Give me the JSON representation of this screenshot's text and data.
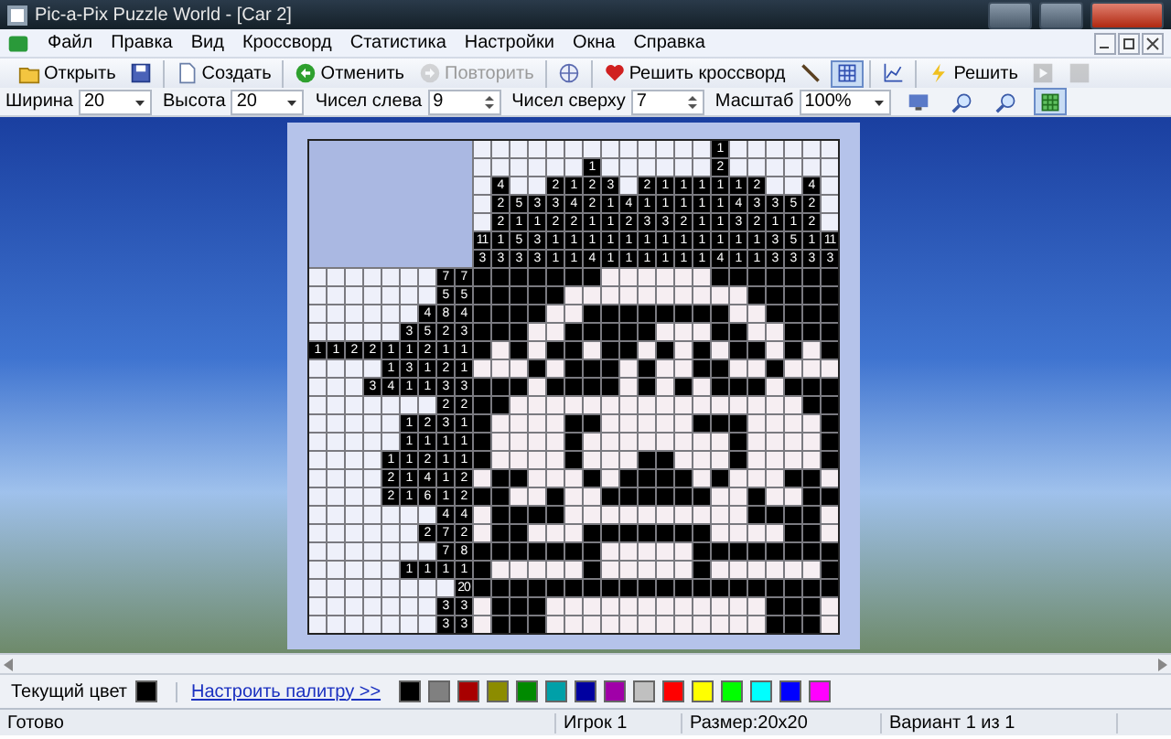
{
  "window": {
    "title": "Pic-a-Pix Puzzle World - [Car 2]"
  },
  "menu": [
    "Файл",
    "Правка",
    "Вид",
    "Кроссворд",
    "Статистика",
    "Настройки",
    "Окна",
    "Справка"
  ],
  "toolbar": [
    {
      "items": [
        {
          "label": "Открыть",
          "disabled": false,
          "pressed": false
        },
        {
          "disabled": false,
          "pressed": false
        }
      ]
    },
    {
      "items": [
        {
          "label": "Создать",
          "disabled": false,
          "pressed": false
        }
      ]
    },
    {
      "items": [
        {
          "label": "Отменить",
          "disabled": false,
          "pressed": false
        },
        {
          "label": "Повторить",
          "disabled": true,
          "pressed": false
        }
      ]
    },
    {
      "items": [
        {
          "disabled": false,
          "pressed": false
        }
      ]
    },
    {
      "items": [
        {
          "label": "Решить кроссворд",
          "disabled": false,
          "pressed": false
        },
        {
          "disabled": false,
          "pressed": false
        },
        {
          "disabled": false,
          "pressed": true
        }
      ]
    },
    {
      "items": [
        {
          "disabled": false,
          "pressed": false
        }
      ]
    },
    {
      "items": [
        {
          "label": "Решить",
          "disabled": false,
          "pressed": false
        },
        {
          "disabled": true,
          "pressed": false
        },
        {
          "disabled": true,
          "pressed": false
        }
      ]
    }
  ],
  "settings": [
    {
      "kind": "dropdown",
      "label": "Ширина",
      "value": "20"
    },
    {
      "kind": "dropdown",
      "label": "Высота",
      "value": "20"
    },
    {
      "kind": "spinner",
      "label": "Чисел слева",
      "value": "9"
    },
    {
      "kind": "spinner",
      "label": "Чисел сверху",
      "value": "7"
    },
    {
      "kind": "dropdown",
      "label": "Масштаб",
      "value": "100%"
    }
  ],
  "view_buttons": [
    {
      "pressed": false
    },
    {
      "pressed": false
    },
    {
      "pressed": false
    },
    {
      "pressed": true
    }
  ],
  "puzzle": {
    "column_clues": [
      [
        "11",
        "3"
      ],
      [
        "4",
        "2",
        "2",
        "1",
        "3"
      ],
      [
        "5",
        "1",
        "5",
        "3"
      ],
      [
        "3",
        "1",
        "3",
        "3"
      ],
      [
        "2",
        "3",
        "2",
        "1",
        "1"
      ],
      [
        "1",
        "4",
        "2",
        "1",
        "1"
      ],
      [
        "1",
        "2",
        "2",
        "1",
        "1",
        "4"
      ],
      [
        "3",
        "1",
        "1",
        "1",
        "1"
      ],
      [
        "4",
        "2",
        "1",
        "1"
      ],
      [
        "2",
        "1",
        "3",
        "1",
        "1"
      ],
      [
        "1",
        "1",
        "3",
        "1",
        "1"
      ],
      [
        "1",
        "1",
        "2",
        "1",
        "1"
      ],
      [
        "1",
        "1",
        "1",
        "1",
        "1"
      ],
      [
        "1",
        "2",
        "1",
        "1",
        "1",
        "1",
        "4"
      ],
      [
        "1",
        "4",
        "3",
        "1",
        "1"
      ],
      [
        "2",
        "3",
        "2",
        "1",
        "1"
      ],
      [
        "3",
        "1",
        "3",
        "3"
      ],
      [
        "5",
        "1",
        "5",
        "3"
      ],
      [
        "4",
        "2",
        "2",
        "1",
        "3"
      ],
      [
        "11",
        "3"
      ]
    ],
    "row_clues": [
      [
        "7",
        "7"
      ],
      [
        "5",
        "5"
      ],
      [
        "4",
        "8",
        "4"
      ],
      [
        "3",
        "5",
        "2",
        "3"
      ],
      [
        "1",
        "1",
        "2",
        "2",
        "1",
        "1",
        "2",
        "1",
        "1"
      ],
      [
        "1",
        "3",
        "1",
        "2",
        "1"
      ],
      [
        "3",
        "4",
        "1",
        "1",
        "3",
        "3"
      ],
      [
        "2",
        "2"
      ],
      [
        "1",
        "2",
        "3",
        "1"
      ],
      [
        "1",
        "1",
        "1",
        "1"
      ],
      [
        "1",
        "1",
        "2",
        "1",
        "1"
      ],
      [
        "2",
        "1",
        "4",
        "1",
        "2"
      ],
      [
        "2",
        "1",
        "6",
        "1",
        "2"
      ],
      [
        "4",
        "4"
      ],
      [
        "2",
        "7",
        "2"
      ],
      [
        "7",
        "8"
      ],
      [
        "1",
        "1",
        "1",
        "1"
      ],
      [
        "20"
      ],
      [
        "3",
        "3"
      ],
      [
        "3",
        "3"
      ]
    ],
    "cells": [
      [
        true,
        true,
        true,
        true,
        true,
        true,
        true,
        false,
        false,
        false,
        false,
        false,
        false,
        true,
        true,
        true,
        true,
        true,
        true,
        true
      ],
      [
        true,
        true,
        true,
        true,
        true,
        false,
        false,
        false,
        false,
        false,
        false,
        false,
        false,
        false,
        false,
        true,
        true,
        true,
        true,
        true
      ],
      [
        true,
        true,
        true,
        true,
        false,
        false,
        true,
        true,
        true,
        true,
        true,
        true,
        true,
        true,
        false,
        false,
        true,
        true,
        true,
        true
      ],
      [
        true,
        true,
        true,
        false,
        false,
        true,
        true,
        true,
        true,
        true,
        false,
        false,
        false,
        true,
        true,
        false,
        false,
        true,
        true,
        true
      ],
      [
        true,
        false,
        true,
        false,
        true,
        true,
        false,
        true,
        true,
        false,
        true,
        false,
        true,
        false,
        true,
        true,
        false,
        true,
        false,
        true
      ],
      [
        false,
        false,
        false,
        true,
        false,
        true,
        true,
        true,
        false,
        true,
        false,
        false,
        true,
        true,
        false,
        false,
        true,
        false,
        false,
        false
      ],
      [
        true,
        true,
        true,
        false,
        true,
        true,
        true,
        true,
        false,
        true,
        false,
        true,
        false,
        true,
        true,
        true,
        false,
        true,
        true,
        true
      ],
      [
        true,
        true,
        false,
        false,
        false,
        false,
        false,
        false,
        false,
        false,
        false,
        false,
        false,
        false,
        false,
        false,
        false,
        false,
        true,
        true
      ],
      [
        true,
        false,
        false,
        false,
        false,
        true,
        true,
        false,
        false,
        false,
        false,
        false,
        true,
        true,
        true,
        false,
        false,
        false,
        false,
        true
      ],
      [
        true,
        false,
        false,
        false,
        false,
        true,
        false,
        false,
        false,
        false,
        false,
        false,
        false,
        false,
        true,
        false,
        false,
        false,
        false,
        true
      ],
      [
        true,
        false,
        false,
        false,
        false,
        true,
        false,
        false,
        false,
        true,
        true,
        false,
        false,
        false,
        true,
        false,
        false,
        false,
        false,
        true
      ],
      [
        false,
        true,
        true,
        false,
        false,
        false,
        true,
        false,
        true,
        true,
        true,
        true,
        false,
        true,
        false,
        false,
        false,
        true,
        true,
        false
      ],
      [
        true,
        true,
        false,
        false,
        true,
        false,
        false,
        true,
        true,
        true,
        true,
        true,
        true,
        false,
        false,
        true,
        false,
        false,
        true,
        true
      ],
      [
        false,
        true,
        true,
        true,
        true,
        false,
        false,
        false,
        false,
        false,
        false,
        false,
        false,
        false,
        false,
        true,
        true,
        true,
        true,
        false
      ],
      [
        false,
        true,
        true,
        false,
        false,
        false,
        true,
        true,
        true,
        true,
        true,
        true,
        true,
        false,
        false,
        false,
        false,
        true,
        true,
        false
      ],
      [
        true,
        true,
        true,
        true,
        true,
        true,
        true,
        false,
        false,
        false,
        false,
        false,
        true,
        true,
        true,
        true,
        true,
        true,
        true,
        true
      ],
      [
        true,
        false,
        false,
        false,
        false,
        false,
        true,
        false,
        false,
        false,
        false,
        false,
        true,
        false,
        false,
        false,
        false,
        false,
        false,
        true
      ],
      [
        true,
        true,
        true,
        true,
        true,
        true,
        true,
        true,
        true,
        true,
        true,
        true,
        true,
        true,
        true,
        true,
        true,
        true,
        true,
        true
      ],
      [
        false,
        true,
        true,
        true,
        false,
        false,
        false,
        false,
        false,
        false,
        false,
        false,
        false,
        false,
        false,
        false,
        true,
        true,
        true,
        false
      ],
      [
        false,
        true,
        true,
        true,
        false,
        false,
        false,
        false,
        false,
        false,
        false,
        false,
        false,
        false,
        false,
        false,
        true,
        true,
        true,
        false
      ]
    ]
  },
  "palette": {
    "current": {
      "label": "Текущий цвет",
      "color": "#000000"
    },
    "link": "Настроить палитру >>",
    "colors": [
      {
        "color": "#000000"
      },
      {
        "color": "#808080"
      },
      {
        "color": "#a80000"
      },
      {
        "color": "#8c8c00"
      },
      {
        "color": "#008a00"
      },
      {
        "color": "#00a0a8"
      },
      {
        "color": "#0000a0"
      },
      {
        "color": "#a000a8"
      },
      {
        "color": "#c0c0c0"
      },
      {
        "color": "#ff0000"
      },
      {
        "color": "#ffff00"
      },
      {
        "color": "#00ff00"
      },
      {
        "color": "#00ffff"
      },
      {
        "color": "#0000ff"
      },
      {
        "color": "#ff00ff"
      }
    ]
  },
  "status_bar": [
    "Готово",
    "Игрок 1",
    "Размер:20x20",
    "Вариант 1 из 1"
  ]
}
